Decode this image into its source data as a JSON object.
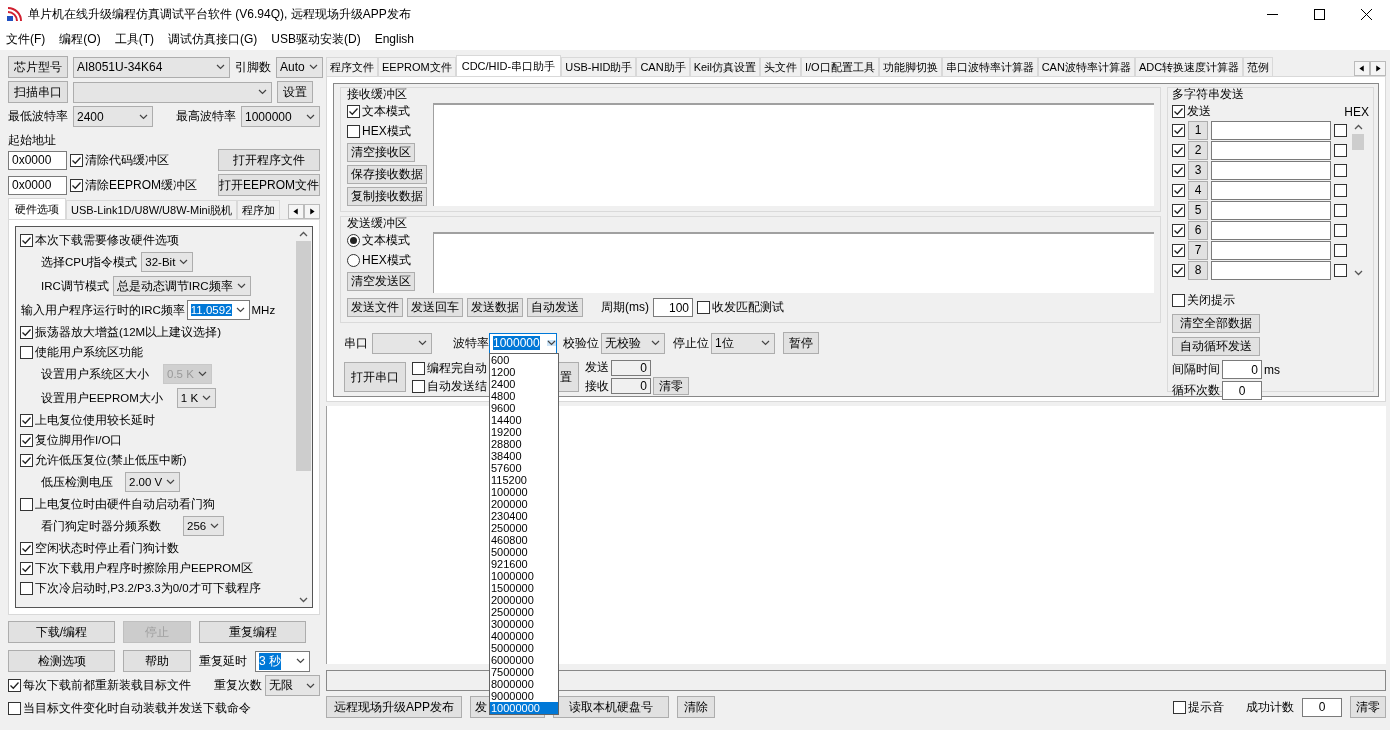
{
  "window": {
    "title": "单片机在线升级编程仿真调试平台软件 (V6.94Q), 远程现场升级APP发布"
  },
  "menu": [
    "文件(F)",
    "编程(O)",
    "工具(T)",
    "调试仿真接口(G)",
    "USB驱动安装(D)",
    "English"
  ],
  "left": {
    "chip_button": "芯片型号",
    "chip": "AI8051U-34K64",
    "pins_label": "引脚数",
    "pins": "Auto",
    "scan_button": "扫描串口",
    "setup_button": "设置",
    "min_baud_label": "最低波特率",
    "min_baud": "2400",
    "max_baud_label": "最高波特率",
    "max_baud": "1000000",
    "start_address_label": "起始地址",
    "buffers": [
      {
        "address": "0x0000",
        "label": "清除代码缓冲区",
        "checked": true,
        "button": "打开程序文件"
      },
      {
        "address": "0x0000",
        "label": "清除EEPROM缓冲区",
        "checked": true,
        "button": "打开EEPROM文件"
      }
    ],
    "tabs": [
      {
        "label": "硬件选项",
        "selected": true
      },
      {
        "label": "USB-Link1D/U8W/U8W-Mini脱机",
        "selected": false
      },
      {
        "label": "程序加",
        "selected": false
      }
    ],
    "options": [
      {
        "kind": "check",
        "label": "本次下载需要修改硬件选项",
        "checked": true
      },
      {
        "kind": "select",
        "label": "选择CPU指令模式",
        "value": "32-Bit",
        "disabled": false
      },
      {
        "kind": "select",
        "label": "IRC调节模式",
        "value": "总是动态调节IRC频率",
        "disabled": false
      },
      {
        "kind": "entry",
        "label": "输入用户程序运行时的IRC频率",
        "value": "11.0592",
        "unit": "MHz",
        "selected": true
      },
      {
        "kind": "check",
        "label": "振荡器放大增益(12M以上建议选择)",
        "checked": true
      },
      {
        "kind": "check",
        "label": "使能用户系统区功能",
        "checked": false
      },
      {
        "kind": "select",
        "label": "设置用户系统区大小",
        "value": "0.5 K",
        "disabled": true
      },
      {
        "kind": "select",
        "label": "设置用户EEPROM大小",
        "value": "1   K",
        "disabled": false
      },
      {
        "kind": "check",
        "label": "上电复位使用较长延时",
        "checked": true
      },
      {
        "kind": "check",
        "label": "复位脚用作I/O口",
        "checked": true
      },
      {
        "kind": "check",
        "label": "允许低压复位(禁止低压中断)",
        "checked": true
      },
      {
        "kind": "select",
        "label": "低压检测电压",
        "value": "2.00 V",
        "disabled": false
      },
      {
        "kind": "check",
        "label": "上电复位时由硬件自动启动看门狗",
        "checked": false
      },
      {
        "kind": "select",
        "label": "看门狗定时器分频系数",
        "value": "256",
        "disabled": false
      },
      {
        "kind": "check",
        "label": "空闲状态时停止看门狗计数",
        "checked": true
      },
      {
        "kind": "check",
        "label": "下次下载用户程序时擦除用户EEPROM区",
        "checked": true
      },
      {
        "kind": "check",
        "label": "下次冷启动时,P3.2/P3.3为0/0才可下载程序",
        "checked": false
      }
    ],
    "buttons": [
      {
        "label": "下载/编程",
        "disabled": false
      },
      {
        "label": "停止",
        "disabled": true
      },
      {
        "label": "重复编程",
        "disabled": false
      },
      {
        "label": "检测选项",
        "disabled": false
      },
      {
        "label": "帮助",
        "disabled": false
      }
    ],
    "repeat_delay": {
      "label": "重复延时",
      "value": "3 秒",
      "selected": true
    },
    "repeat_count": {
      "label": "重复次数",
      "value": "无限"
    },
    "checks": [
      {
        "label": "每次下载前都重新装载目标文件",
        "checked": true
      },
      {
        "label": "当目标文件变化时自动装载并发送下载命令",
        "checked": false
      }
    ]
  },
  "right": {
    "tabs": [
      {
        "label": "程序文件",
        "selected": false
      },
      {
        "label": "EEPROM文件",
        "selected": false
      },
      {
        "label": "CDC/HID-串口助手",
        "selected": true
      },
      {
        "label": "USB-HID助手",
        "selected": false
      },
      {
        "label": "CAN助手",
        "selected": false
      },
      {
        "label": "Keil仿真设置",
        "selected": false
      },
      {
        "label": "头文件",
        "selected": false
      },
      {
        "label": "I/O口配置工具",
        "selected": false
      },
      {
        "label": "功能脚切换",
        "selected": false
      },
      {
        "label": "串口波特率计算器",
        "selected": false
      },
      {
        "label": "CAN波特率计算器",
        "selected": false
      },
      {
        "label": "ADC转换速度计算器",
        "selected": false
      },
      {
        "label": "范例",
        "selected": false
      }
    ],
    "receive": {
      "title": "接收缓冲区",
      "modes": [
        {
          "label": "文本模式",
          "checked": true
        },
        {
          "label": "HEX模式",
          "checked": false
        }
      ],
      "buttons": [
        "清空接收区",
        "保存接收数据",
        "复制接收数据"
      ]
    },
    "send": {
      "title": "发送缓冲区",
      "modes": [
        {
          "label": "文本模式",
          "selected": true
        },
        {
          "label": "HEX模式",
          "selected": false
        }
      ],
      "buttons": [
        "清空发送区"
      ],
      "actions": [
        "发送文件",
        "发送回车",
        "发送数据",
        "自动发送"
      ],
      "period_label": "周期(ms)",
      "period": "100",
      "match_test": {
        "label": "收发匹配测试",
        "checked": false
      }
    },
    "serial": {
      "port_label": "串口",
      "baud_label": "波特率",
      "baud": "1000000",
      "baud_selected": true,
      "baud_options": [
        {
          "value": "600",
          "selected": false
        },
        {
          "value": "1200",
          "selected": false
        },
        {
          "value": "2400",
          "selected": false
        },
        {
          "value": "4800",
          "selected": false
        },
        {
          "value": "9600",
          "selected": false
        },
        {
          "value": "14400",
          "selected": false
        },
        {
          "value": "19200",
          "selected": false
        },
        {
          "value": "28800",
          "selected": false
        },
        {
          "value": "38400",
          "selected": false
        },
        {
          "value": "57600",
          "selected": false
        },
        {
          "value": "115200",
          "selected": false
        },
        {
          "value": "100000",
          "selected": false
        },
        {
          "value": "200000",
          "selected": false
        },
        {
          "value": "230400",
          "selected": false
        },
        {
          "value": "250000",
          "selected": false
        },
        {
          "value": "460800",
          "selected": false
        },
        {
          "value": "500000",
          "selected": false
        },
        {
          "value": "921600",
          "selected": false
        },
        {
          "value": "1000000",
          "selected": false
        },
        {
          "value": "1500000",
          "selected": false
        },
        {
          "value": "2000000",
          "selected": false
        },
        {
          "value": "2500000",
          "selected": false
        },
        {
          "value": "3000000",
          "selected": false
        },
        {
          "value": "4000000",
          "selected": false
        },
        {
          "value": "5000000",
          "selected": false
        },
        {
          "value": "6000000",
          "selected": false
        },
        {
          "value": "7500000",
          "selected": false
        },
        {
          "value": "8000000",
          "selected": false
        },
        {
          "value": "9000000",
          "selected": false
        },
        {
          "value": "10000000",
          "selected": true
        }
      ],
      "parity_label": "校验位",
      "parity": "无校验",
      "stop_label": "停止位",
      "stop": "1位",
      "pause_button": "暂停",
      "open_button": "打开串口",
      "options": [
        {
          "label": "编程完自动",
          "checked": false
        },
        {
          "label": "自动发送结",
          "checked": false
        }
      ],
      "hidden_button": "置",
      "tx_label": "发送",
      "tx": "0",
      "rx_label": "接收",
      "rx": "0",
      "clear_button": "清零"
    },
    "multi": {
      "title": "多字符串发送",
      "send_all": {
        "label": "发送",
        "checked": true
      },
      "hex_label": "HEX",
      "rows": [
        {
          "index": "1",
          "checked": true,
          "hex": false
        },
        {
          "index": "2",
          "checked": true,
          "hex": false
        },
        {
          "index": "3",
          "checked": true,
          "hex": false
        },
        {
          "index": "4",
          "checked": true,
          "hex": false
        },
        {
          "index": "5",
          "checked": true,
          "hex": false
        },
        {
          "index": "6",
          "checked": true,
          "hex": false
        },
        {
          "index": "7",
          "checked": true,
          "hex": false
        },
        {
          "index": "8",
          "checked": true,
          "hex": false
        }
      ],
      "close_tip": {
        "label": "关闭提示",
        "checked": false
      },
      "buttons": [
        "清空全部数据",
        "自动循环发送"
      ],
      "interval_label": "间隔时间",
      "interval": "0",
      "interval_unit": "ms",
      "loop_label": "循环次数",
      "loop": "0"
    },
    "bottom": {
      "buttons": [
        "远程现场升级APP发布",
        "发",
        "读取本机硬盘号",
        "清除"
      ],
      "sound": {
        "label": "提示音",
        "checked": false
      },
      "count_label": "成功计数",
      "count": "0",
      "clear_button": "清零"
    }
  }
}
